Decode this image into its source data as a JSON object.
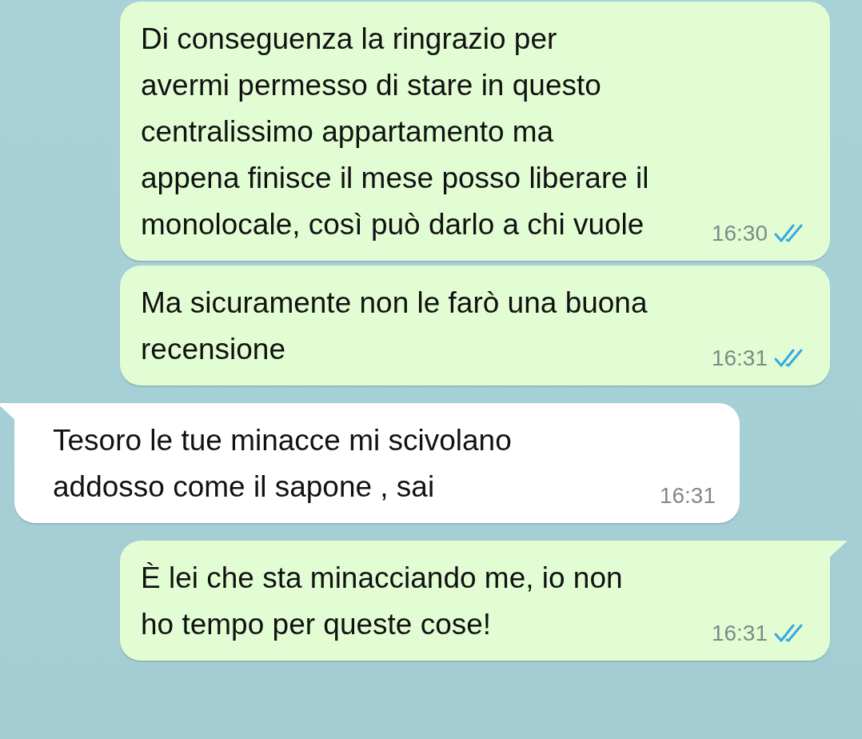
{
  "messages": [
    {
      "kind": "outgoing",
      "tail": false,
      "lines": [
        "Di conseguenza la ringrazio per",
        "avermi permesso di stare in questo",
        "centralissimo appartamento ma",
        "appena finisce il mese posso liberare il",
        "monolocale, così può darlo a chi vuole"
      ],
      "time": "16:30",
      "read": true
    },
    {
      "kind": "outgoing",
      "tail": false,
      "lines": [
        "Ma sicuramente non le farò una buona",
        "recensione"
      ],
      "time": "16:31",
      "read": true
    },
    {
      "kind": "incoming",
      "tail": true,
      "lines": [
        "Tesoro le tue minacce mi scivolano",
        "addosso come il sapone , sai"
      ],
      "time": "16:31"
    },
    {
      "kind": "outgoing",
      "tail": true,
      "lines": [
        "È lei che sta minacciando me, io non",
        "ho tempo per queste cose!"
      ],
      "time": "16:31",
      "read": true
    }
  ]
}
